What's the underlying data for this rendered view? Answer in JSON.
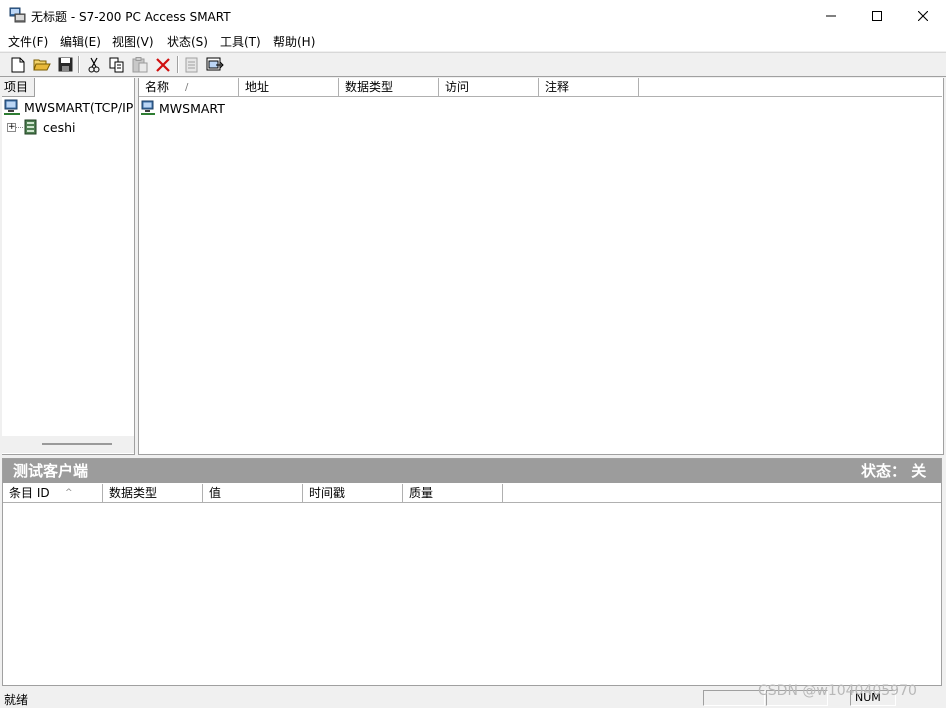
{
  "window": {
    "title": "无标题 - S7-200 PC Access SMART"
  },
  "menu": [
    "文件(F)",
    "编辑(E)",
    "视图(V)",
    "状态(S)",
    "工具(T)",
    "帮助(H)"
  ],
  "toolbar": [
    "new-icon",
    "open-icon",
    "save-icon",
    "cut-icon",
    "copy-icon",
    "paste-icon",
    "delete-icon",
    "properties-icon",
    "add-to-client-icon"
  ],
  "tree": {
    "header": "项目",
    "root": "MWSMART(TCP/IP",
    "child": "ceshi",
    "expander": "+"
  },
  "list": {
    "columns": [
      "名称",
      "地址",
      "数据类型",
      "访问",
      "注释"
    ],
    "sort_indicator": "/",
    "rows": [
      {
        "name": "MWSMART"
      }
    ]
  },
  "client": {
    "title": "测试客户端",
    "status": "状态： 关",
    "columns": [
      "条目 ID",
      "数据类型",
      "值",
      "时间戳",
      "质量"
    ],
    "sort_indicator": "^"
  },
  "statusbar": {
    "text": "就绪",
    "num": "NUM",
    "watermark": "CSDN @w1040405970"
  }
}
